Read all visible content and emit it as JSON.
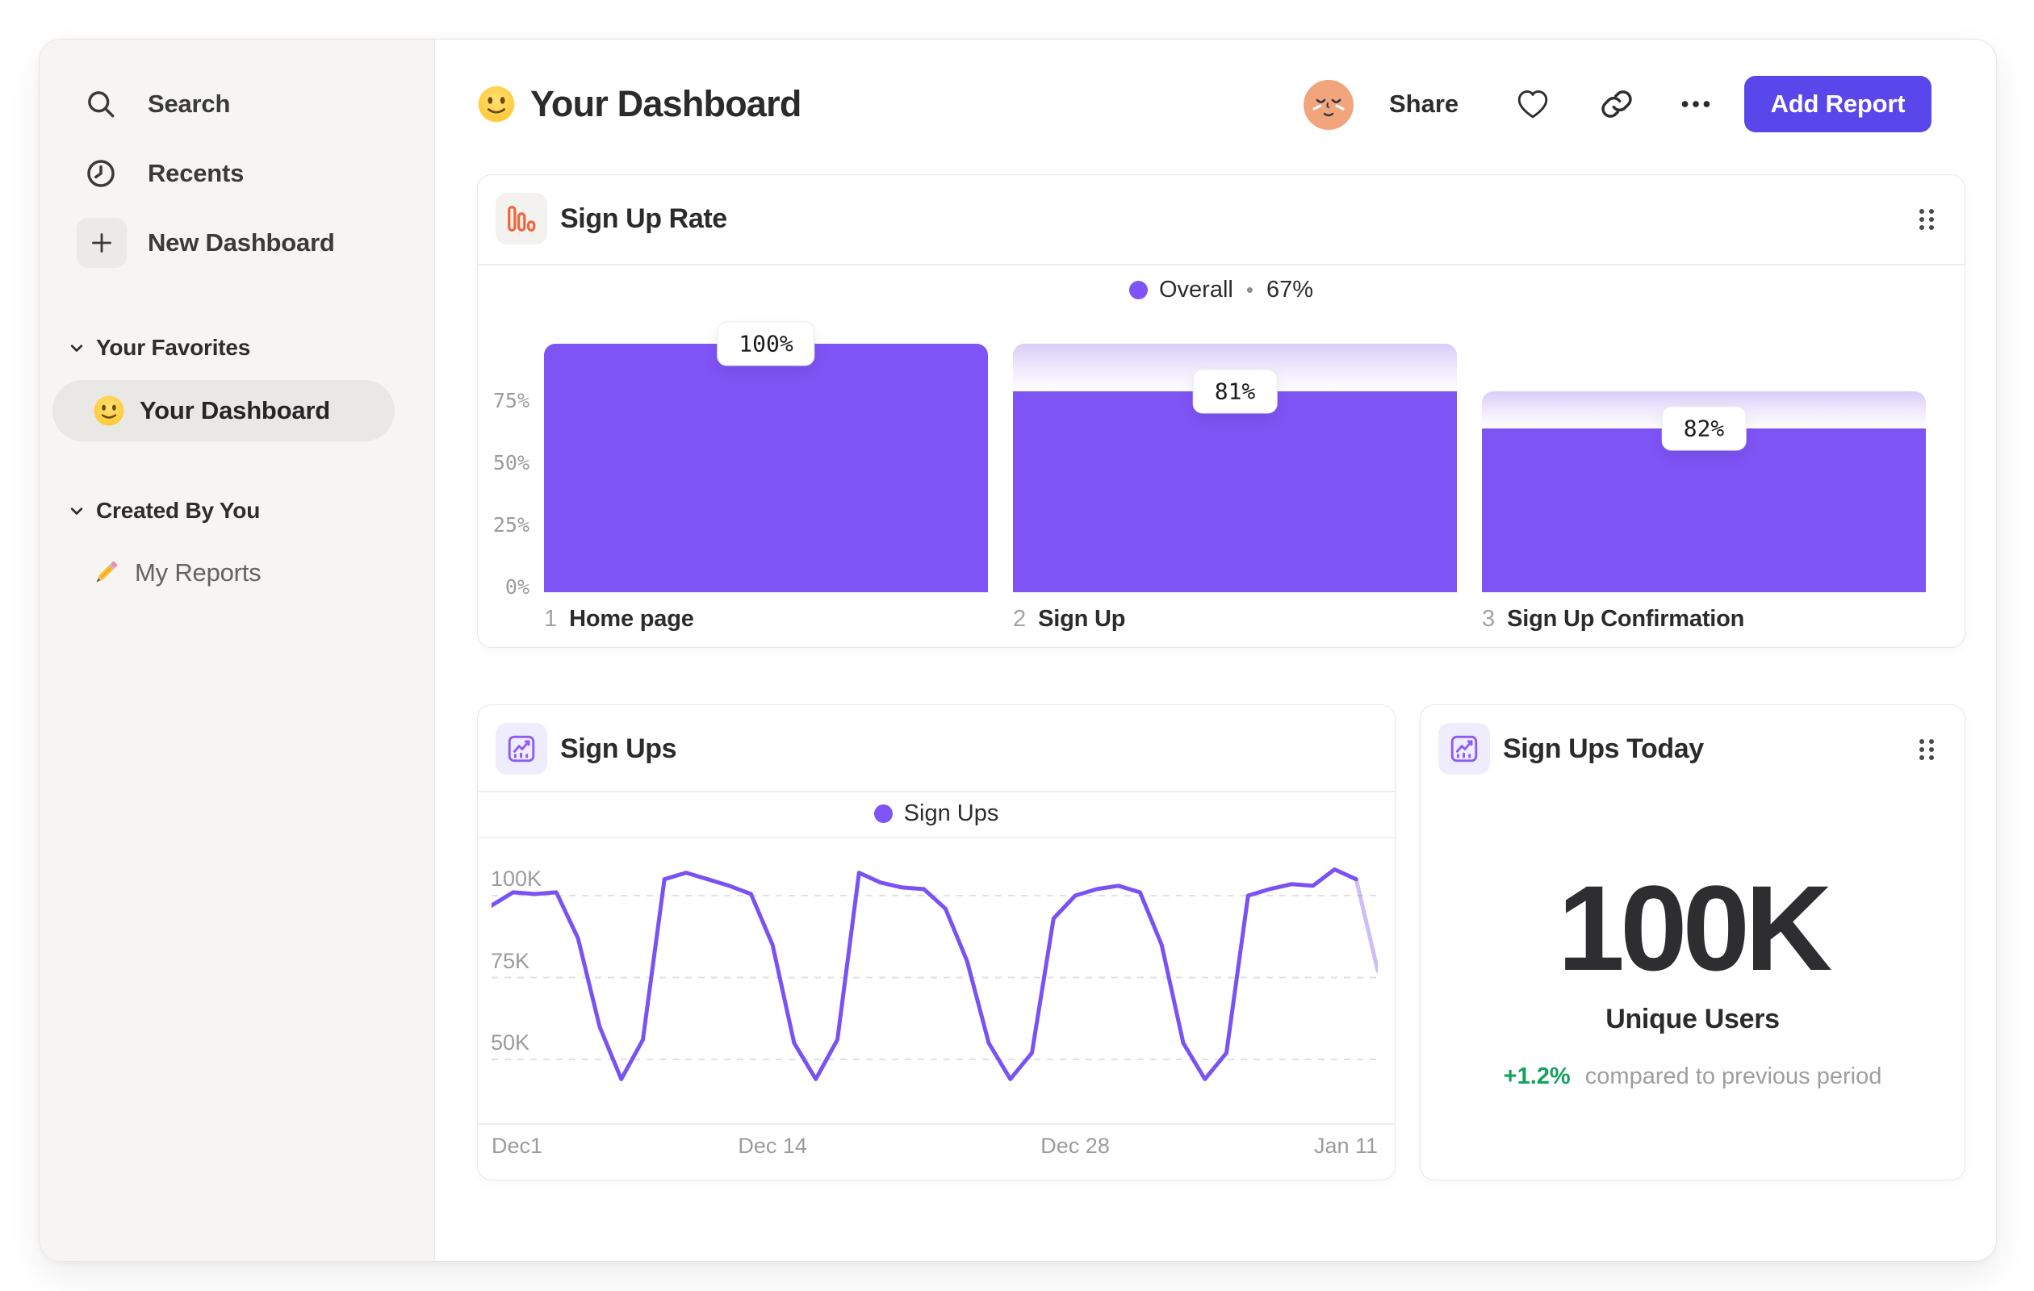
{
  "sidebar": {
    "nav": [
      {
        "label": "Search",
        "icon": "search-icon"
      },
      {
        "label": "Recents",
        "icon": "clock-icon"
      },
      {
        "label": "New Dashboard",
        "icon": "plus-icon"
      }
    ],
    "sections": [
      {
        "label": "Your Favorites",
        "items": [
          {
            "label": "Your Dashboard",
            "icon": "smiley-emoji",
            "active": true
          }
        ]
      },
      {
        "label": "Created By You",
        "items": [
          {
            "label": "My Reports",
            "icon": "pencil-emoji",
            "active": false
          }
        ]
      }
    ]
  },
  "header": {
    "title": "Your Dashboard",
    "title_emoji": "smiley-emoji",
    "share_label": "Share",
    "add_report_label": "Add Report"
  },
  "cards": {
    "signup_rate": {
      "title": "Sign Up Rate",
      "icon": "funnel-chart-icon",
      "legend_name": "Overall",
      "legend_separator": "•",
      "legend_value": "67%"
    },
    "signups": {
      "title": "Sign Ups",
      "icon": "line-chart-icon",
      "legend_name": "Sign Ups"
    },
    "signups_today": {
      "title": "Sign Ups Today",
      "icon": "line-chart-icon",
      "value": "100K",
      "value_label": "Unique Users",
      "delta": "+1.2%",
      "delta_caption": "compared to previous period"
    }
  },
  "colors": {
    "accent_purple": "#7e54f5",
    "line_purple": "#7a52f4",
    "button_purple": "#5947ec",
    "ghost_purple": "#d9ccf9",
    "icon_orange": "#f0653c",
    "positive_green": "#17a05e",
    "sidebar_bg": "#f6f5f3",
    "text_dark": "#2d2d2d",
    "text_gray": "#9b9b9b"
  },
  "chart_data": [
    {
      "type": "bar",
      "subtype": "funnel",
      "title": "Sign Up Rate",
      "legend": [
        "Overall • 67%"
      ],
      "legend_position": "top-center",
      "categories": [
        "Home page",
        "Sign Up",
        "Sign Up Confirmation"
      ],
      "step_numbers": [
        "1",
        "2",
        "3"
      ],
      "step_conversion_labels": [
        "100%",
        "81%",
        "82%"
      ],
      "overall_pct": [
        100,
        81,
        66
      ],
      "prev_pct": [
        100,
        100,
        81
      ],
      "overall_conversion": "67%",
      "y_ticks": [
        "75%",
        "50%",
        "25%",
        "0%"
      ],
      "y_tick_values": [
        75,
        50,
        25,
        0
      ],
      "ylim": [
        0,
        100
      ],
      "grid": false
    },
    {
      "type": "line",
      "title": "Sign Ups",
      "legend": [
        "Sign Ups"
      ],
      "legend_position": "top-center",
      "xlabel": "",
      "ylabel": "",
      "x_ticks": [
        "Dec1",
        "Dec 14",
        "Dec 28",
        "Jan 11"
      ],
      "x_tick_days": [
        0,
        13,
        27,
        41
      ],
      "y_ticks": [
        "100K",
        "75K",
        "50K"
      ],
      "y_tick_values": [
        100,
        75,
        50
      ],
      "ylim": [
        38,
        112
      ],
      "unit": "K",
      "grid": "dashed-horizontal",
      "values": [
        97,
        101,
        100.5,
        101,
        87,
        60,
        44,
        56,
        105,
        107,
        105,
        103,
        100.5,
        85,
        55,
        44,
        56,
        107,
        104,
        102.5,
        102,
        96,
        80,
        55,
        44,
        52,
        93,
        100,
        102,
        103,
        101,
        85,
        55,
        44,
        52,
        100,
        102,
        103.5,
        103,
        108,
        105,
        77
      ],
      "faded_tail_points": 1
    }
  ]
}
